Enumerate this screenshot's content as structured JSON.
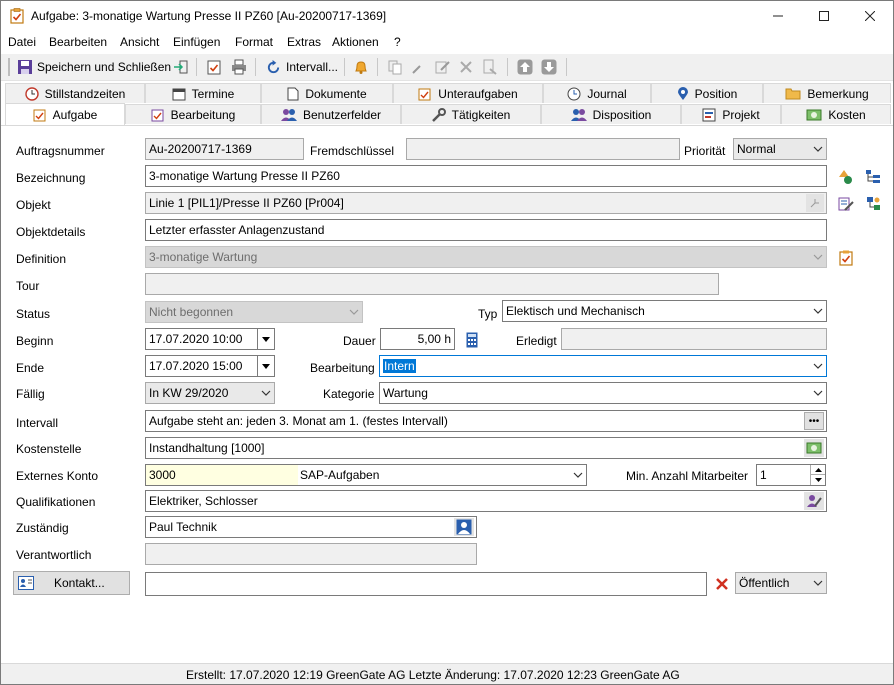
{
  "window": {
    "title": "Aufgabe: 3-monatige Wartung Presse II PZ60 [Au-20200717-1369]",
    "minimize": "—",
    "maximize": "☐",
    "close": "✕"
  },
  "menu": [
    "Datei",
    "Bearbeiten",
    "Ansicht",
    "Einfügen",
    "Format",
    "Extras",
    "Aktionen",
    "?"
  ],
  "toolbar": {
    "save_close": "Speichern und Schließen",
    "interval": "Intervall..."
  },
  "tabs_row1": [
    "Stillstandzeiten",
    "Termine",
    "Dokumente",
    "Unteraufgaben",
    "Journal",
    "Position",
    "Bemerkung"
  ],
  "tabs_row2": [
    "Aufgabe",
    "Bearbeitung",
    "Benutzerfelder",
    "Tätigkeiten",
    "Disposition",
    "Projekt",
    "Kosten"
  ],
  "form": {
    "auftragsnummer_label": "Auftragsnummer",
    "auftragsnummer": "Au-20200717-1369",
    "fremdschluessel_label": "Fremdschlüssel",
    "fremdschluessel": "",
    "prioritaet_label": "Priorität",
    "prioritaet": "Normal",
    "bezeichnung_label": "Bezeichnung",
    "bezeichnung": "3-monatige Wartung Presse II PZ60",
    "objekt_label": "Objekt",
    "objekt": "Linie 1 [PIL1]/Presse II PZ60 [Pr004]",
    "objektdetails_label": "Objektdetails",
    "objektdetails": "Letzter erfasster Anlagenzustand",
    "definition_label": "Definition",
    "definition": "3-monatige Wartung",
    "tour_label": "Tour",
    "tour": "",
    "status_label": "Status",
    "status": "Nicht begonnen",
    "typ_label": "Typ",
    "typ": "Elektisch und Mechanisch",
    "beginn_label": "Beginn",
    "beginn": "17.07.2020 10:00",
    "dauer_label": "Dauer",
    "dauer": "5,00 h",
    "erledigt_label": "Erledigt",
    "erledigt": "",
    "ende_label": "Ende",
    "ende": "17.07.2020 15:00",
    "bearbeitung_label": "Bearbeitung",
    "bearbeitung": "Intern",
    "faellig_label": "Fällig",
    "faellig": "In KW 29/2020",
    "kategorie_label": "Kategorie",
    "kategorie": "Wartung",
    "intervall_label": "Intervall",
    "intervall": "Aufgabe steht an: jeden 3. Monat am 1.  (festes Intervall)",
    "kostenstelle_label": "Kostenstelle",
    "kostenstelle": "Instandhaltung [1000]",
    "externes_konto_label": "Externes Konto",
    "externes_konto": "3000",
    "externes_konto_desc": "SAP-Aufgaben",
    "min_mitarbeiter_label": "Min. Anzahl Mitarbeiter",
    "min_mitarbeiter": "1",
    "qualifikationen_label": "Qualifikationen",
    "qualifikationen": "Elektriker, Schlosser",
    "zustaendig_label": "Zuständig",
    "zustaendig": "Paul Technik",
    "verantwortlich_label": "Verantwortlich",
    "verantwortlich": "",
    "kontakt_button": "Kontakt...",
    "kontakt": "",
    "sichtbarkeit": "Öffentlich"
  },
  "status": "Erstellt: 17.07.2020 12:19 GreenGate AG  Letzte Änderung: 17.07.2020 12:23 GreenGate AG",
  "icons": {
    "window": "task-icon",
    "accent": "#0078d7"
  }
}
